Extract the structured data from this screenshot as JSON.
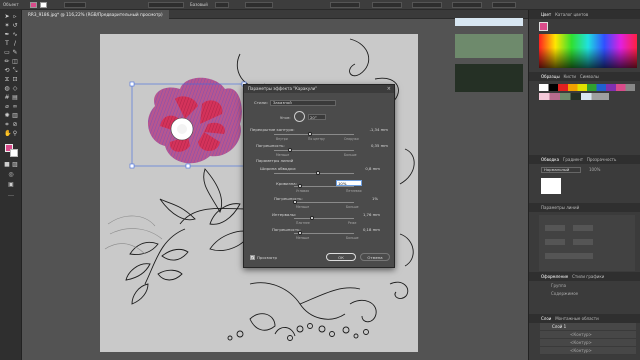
{
  "document_tab": "RR3_9186.jpg* @ 116,22% (RGB/Предварительный просмотр)",
  "control_bar": {
    "selection_label": "Объект",
    "field_1": "Базовый"
  },
  "panels": {
    "color_tab": "Цвет",
    "color_guide_tab": "Каталог цветов",
    "swatches_tab": "Образцы",
    "brushes_tab": "Кисти",
    "symbols_tab": "Символы",
    "stroke_tab": "Обводка",
    "gradient_tab": "Градиент",
    "transparency_tab": "Прозрачность",
    "blend_mode": "Нормальный",
    "opacity_value": "100%",
    "brush_section": "Параметры линий",
    "appearance_tab": "Оформление",
    "graphic_styles_tab": "Стили графики",
    "appearance_group": "Группа",
    "appearance_contents": "Содержимое",
    "layers_tab": "Слои",
    "artboards_tab": "Монтажные области",
    "layer_name": "Слой 1",
    "layer_rows": [
      "<Контур>",
      "<Контур>",
      "<Контур>",
      "<Контур>",
      "<Контур>"
    ],
    "swatch_colors": [
      "#d8e7f2",
      "#6e8a6c",
      "#253025"
    ]
  },
  "dialog": {
    "title": "Параметры эффекта \"Каракули\"",
    "close_label": "×",
    "settings_label": "Стили:",
    "settings_value": "Заказной",
    "angle_label": "Угол:",
    "angle_value": "20°",
    "path_overlap_label": "Перекрытие контура:",
    "path_overlap_value": "-1,34 mm",
    "path_overlap_left": "Внутри",
    "path_overlap_mid": "По центру",
    "path_overlap_right": "Снаружи",
    "variation1_label": "Погрешность:",
    "variation1_value": "0,35 mm",
    "var_none": "Меньше",
    "var_wide": "Больше",
    "line_options_label": "Параметры линий",
    "stroke_width_label": "Ширина обводки:",
    "stroke_width_value": "0,8 mm",
    "curviness_label": "Кривизна:",
    "curviness_value": "10%",
    "curve_angular": "Угловая",
    "curve_loopy": "Петлевая",
    "variation2_label": "Погрешность:",
    "variation2_value": "1%",
    "spacing_label": "Интервалы:",
    "spacing_value": "1,76 mm",
    "spacing_tight": "Плотнее",
    "spacing_loose": "Реже",
    "variation3_label": "Погрешность:",
    "variation3_value": "0,18 mm",
    "preview_label": "Просмотр",
    "ok_label": "ОК",
    "cancel_label": "Отмена"
  },
  "sliders": {
    "path_overlap": 0.45,
    "variation1": 0.2,
    "stroke_width": 0.55,
    "curviness": 0.1,
    "variation2": 0.01,
    "spacing": 0.3,
    "variation3": 0.1
  }
}
